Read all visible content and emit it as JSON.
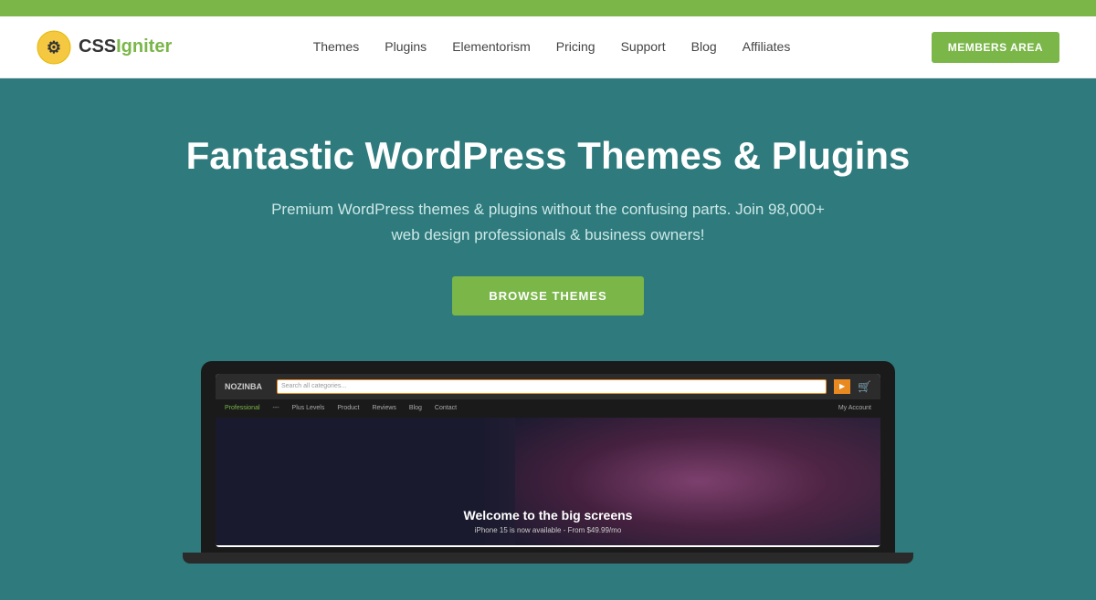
{
  "topBar": {
    "color": "#7ab648"
  },
  "header": {
    "logo": {
      "iconText": "⚙",
      "text": "CSS",
      "textHighlight": "Igniter"
    },
    "nav": {
      "items": [
        {
          "label": "Themes",
          "href": "#"
        },
        {
          "label": "Plugins",
          "href": "#"
        },
        {
          "label": "Elementorism",
          "href": "#"
        },
        {
          "label": "Pricing",
          "href": "#"
        },
        {
          "label": "Support",
          "href": "#"
        },
        {
          "label": "Blog",
          "href": "#"
        },
        {
          "label": "Affiliates",
          "href": "#"
        }
      ]
    },
    "membersButton": "MEMBERS AREA"
  },
  "hero": {
    "title": "Fantastic WordPress Themes & Plugins",
    "subtitle": "Premium WordPress themes & plugins without the confusing parts. Join 98,000+ web design professionals & business owners!",
    "browseButton": "BROWSE THEMES"
  },
  "mockup": {
    "screen": {
      "logoText": "NOZINBA",
      "searchPlaceholder": "Search all categories...",
      "navItems": [
        {
          "label": "Professional",
          "active": true
        },
        {
          "label": "---"
        },
        {
          "label": "Plus Levels"
        },
        {
          "label": "Product"
        },
        {
          "label": "Reviews"
        },
        {
          "label": "Blog"
        },
        {
          "label": "Contact"
        }
      ],
      "accountLabel": "My Account",
      "heroTitle": "Welcome to the big screens",
      "heroSubtitle": "iPhone 15 is now available - From $49.99/mo"
    }
  }
}
